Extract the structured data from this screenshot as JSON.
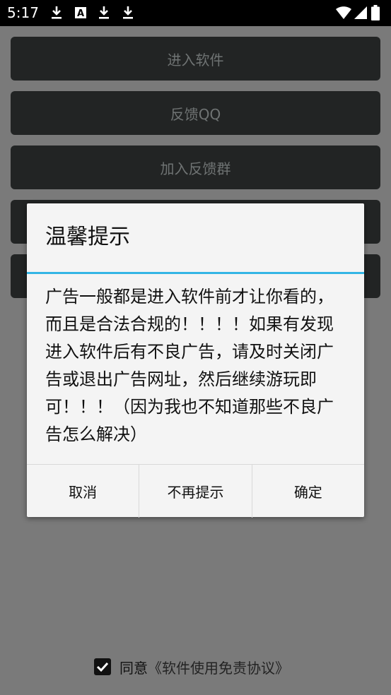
{
  "status_bar": {
    "time": "5:17",
    "icons": [
      "download-icon",
      "a-notification-icon",
      "download-icon",
      "download-icon",
      "wifi-icon",
      "signal-icon",
      "battery-icon"
    ]
  },
  "main": {
    "buttons": [
      {
        "label": "进入软件"
      },
      {
        "label": "反馈QQ"
      },
      {
        "label": "加入反馈群"
      },
      {
        "label": ""
      },
      {
        "label": ""
      }
    ]
  },
  "agreement": {
    "checked": true,
    "label": "同意",
    "link": "《软件使用免责协议》"
  },
  "dialog": {
    "title": "温馨提示",
    "message": "广告一般都是进入软件前才让你看的，而且是合法合规的！！！！如果有发现进入软件后有不良广告，请及时关闭广告或退出广告网址，然后继续游玩即可！！！（因为我也不知道那些不良广告怎么解决）",
    "buttons": {
      "cancel": "取消",
      "no_remind": "不再提示",
      "confirm": "确定"
    }
  },
  "colors": {
    "accent": "#33b5e5",
    "overlay": "#7a7a7a",
    "button_bg": "#222424"
  }
}
